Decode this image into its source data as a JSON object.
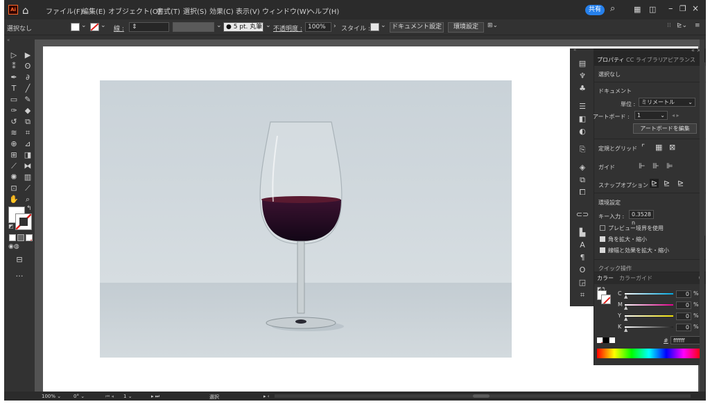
{
  "app": {
    "logo_text": "Ai",
    "share_label": "共有"
  },
  "menu": [
    "ファイル(F)",
    "編集(E)",
    "オブジェクト(O)",
    "書式(T)",
    "選択(S)",
    "効果(C)",
    "表示(V)",
    "ウィンドウ(W)",
    "ヘルプ(H)"
  ],
  "control_bar": {
    "selection_status": "選択なし",
    "stroke_label": "線 :",
    "brush_label": "5 pt. 丸筆",
    "opacity_label": "不透明度 :",
    "opacity_value": "100%",
    "style_label": "スタイル :",
    "doc_setup_button": "ドキュメント設定",
    "preferences_button": "環境設定"
  },
  "properties_panel": {
    "tabs": [
      "プロパティ",
      "CC ライブラリ",
      "アピアランス"
    ],
    "selection_status": "選択なし",
    "document_heading": "ドキュメント",
    "units_label": "単位 :",
    "units_value": "ミリメートル",
    "artboard_label": "アートボード :",
    "artboard_value": "1",
    "edit_artboard_button": "アートボードを編集",
    "rulers_grid_label": "定規とグリッド",
    "guides_label": "ガイド",
    "snap_label": "スナップオプション",
    "prefs_heading": "環境設定",
    "key_increment_label": "キー入力 :",
    "key_increment_value": "0.3528 n",
    "preview_bounds_label": "プレビュー境界を使用",
    "preview_bounds_checked": false,
    "scale_corners_label": "角を拡大・縮小",
    "scale_corners_checked": true,
    "scale_strokes_label": "線幅と効果を拡大・縮小",
    "scale_strokes_checked": true,
    "quick_actions_label": "クイック操作"
  },
  "color_panel": {
    "tabs": [
      "カラー",
      "カラーガイド"
    ],
    "channels": [
      {
        "name": "C",
        "value": "0",
        "unit": "%",
        "color": "#00a8e0"
      },
      {
        "name": "M",
        "value": "0",
        "unit": "%",
        "color": "#e0008a"
      },
      {
        "name": "Y",
        "value": "0",
        "unit": "%",
        "color": "#f0e000"
      },
      {
        "name": "K",
        "value": "0",
        "unit": "%",
        "color": "#222222"
      }
    ],
    "hex_symbol": "#",
    "hex_value": "ffffff"
  },
  "status_bar": {
    "zoom": "100%",
    "rotation": "0°",
    "artboard_number": "1",
    "tool_name": "選択"
  },
  "colors": {
    "accent": "#2680eb",
    "logo": "#ff6a2a",
    "ui_dark": "#323232"
  }
}
